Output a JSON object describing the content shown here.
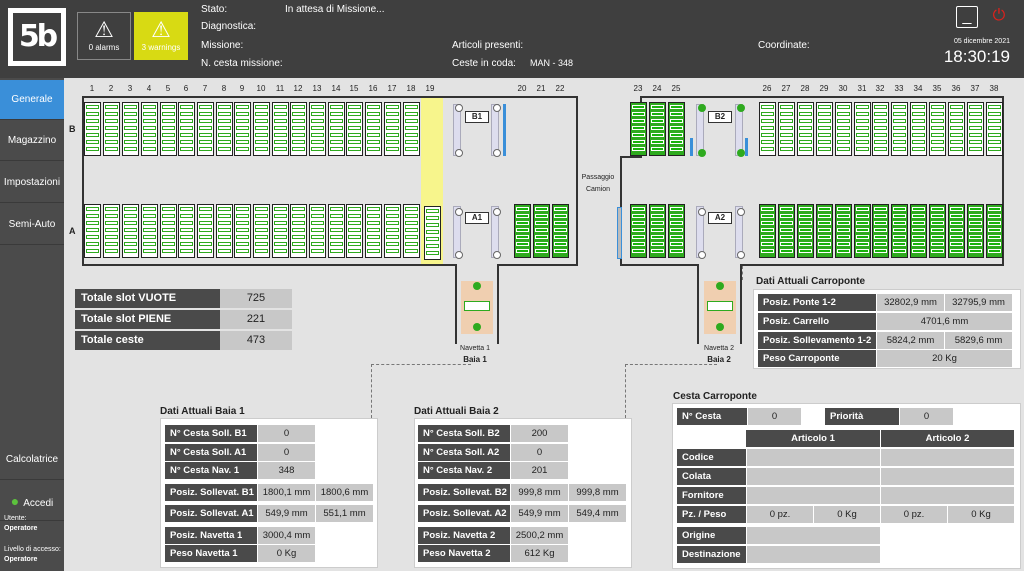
{
  "header": {
    "alarms_label": "0 alarms",
    "warnings_label": "3 warnings",
    "stato_label": "Stato:",
    "stato_value": "In attesa di Missione...",
    "diagnostica_label": "Diagnostica:",
    "missione_label": "Missione:",
    "ncesta_label": "N. cesta missione:",
    "articoli_label": "Articoli presenti:",
    "ceste_label": "Ceste in coda:",
    "ceste_value": "MAN - 348",
    "coordinate_label": "Coordinate:",
    "date": "05 dicembre 2021",
    "time": "18:30:19"
  },
  "sidebar": {
    "items": [
      {
        "label": "Generale"
      },
      {
        "label": "Magazzino"
      },
      {
        "label": "Impostazioni"
      },
      {
        "label": "Semi-Auto"
      }
    ],
    "calcolatrice": "Calcolatrice",
    "accedi": "Accedi",
    "utente_label": "Utente:",
    "utente_value": "Operatore",
    "livello_label": "Livello di accesso:",
    "livello_value": "Operatore"
  },
  "map": {
    "left_cols": [
      "1",
      "2",
      "3",
      "4",
      "5",
      "6",
      "7",
      "8",
      "9",
      "10",
      "11",
      "12",
      "13",
      "14",
      "15",
      "16",
      "17",
      "18",
      "19",
      "20",
      "21",
      "22"
    ],
    "right_cols": [
      "23",
      "24",
      "25",
      "26",
      "27",
      "28",
      "29",
      "30",
      "31",
      "32",
      "33",
      "34",
      "35",
      "36",
      "37",
      "38"
    ],
    "row_b": "B",
    "row_a": "A",
    "b1": "B1",
    "a1": "A1",
    "b2": "B2",
    "a2": "A2",
    "passaggio": "Passaggio",
    "camion": "Camion",
    "navetta1": "Navetta 1",
    "baia1": "Baia 1",
    "navetta2": "Navetta 2",
    "baia2": "Baia 2"
  },
  "summary": [
    {
      "label": "Totale slot VUOTE",
      "value": "725"
    },
    {
      "label": "Totale slot PIENE",
      "value": "221"
    },
    {
      "label": "Totale ceste",
      "value": "473"
    }
  ],
  "carroponte": {
    "title": "Dati Attuali Carroponte",
    "rows": [
      {
        "label": "Posiz. Ponte 1-2",
        "v1": "32802,9 mm",
        "v2": "32795,9 mm"
      },
      {
        "label": "Posiz. Carrello",
        "v1": "4701,6 mm"
      },
      {
        "label": "Posiz. Sollevamento 1-2",
        "v1": "5824,2 mm",
        "v2": "5829,6 mm"
      },
      {
        "label": "Peso Carroponte",
        "v1": "20 Kg"
      }
    ]
  },
  "baia1": {
    "title": "Dati Attuali Baia 1",
    "rows": [
      {
        "label": "N° Cesta Soll. B1",
        "v1": "0"
      },
      {
        "label": "N° Cesta Soll. A1",
        "v1": "0"
      },
      {
        "label": "N° Cesta Nav. 1",
        "v1": "348"
      },
      {
        "label": "Posiz. Sollevat. B1",
        "v1": "1800,1 mm",
        "v2": "1800,6 mm"
      },
      {
        "label": "Posiz. Sollevat. A1",
        "v1": "549,9 mm",
        "v2": "551,1 mm"
      },
      {
        "label": "Posiz. Navetta 1",
        "v1": "3000,4 mm"
      },
      {
        "label": "Peso Navetta 1",
        "v1": "0 Kg"
      }
    ]
  },
  "baia2": {
    "title": "Dati Attuali Baia 2",
    "rows": [
      {
        "label": "N° Cesta Soll. B2",
        "v1": "200"
      },
      {
        "label": "N° Cesta Soll. A2",
        "v1": "0"
      },
      {
        "label": "N° Cesta Nav. 2",
        "v1": "201"
      },
      {
        "label": "Posiz. Sollevat. B2",
        "v1": "999,8 mm",
        "v2": "999,8 mm"
      },
      {
        "label": "Posiz. Sollevat. A2",
        "v1": "549,9 mm",
        "v2": "549,4 mm"
      },
      {
        "label": "Posiz. Navetta 2",
        "v1": "2500,2 mm"
      },
      {
        "label": "Peso Navetta 2",
        "v1": "612 Kg"
      }
    ]
  },
  "cesta": {
    "title": "Cesta Carroponte",
    "ncesta_label": "N° Cesta",
    "ncesta_value": "0",
    "priorita_label": "Priorità",
    "priorita_value": "0",
    "articolo1": "Articolo 1",
    "articolo2": "Articolo 2",
    "codice": "Codice",
    "colata": "Colata",
    "fornitore": "Fornitore",
    "pzpeso": "Pz. / Peso",
    "a1_pz": "0 pz.",
    "a1_kg": "0 Kg",
    "a2_pz": "0 pz.",
    "a2_kg": "0 Kg",
    "origine": "Origine",
    "destinazione": "Destinazione"
  },
  "colors": {
    "accent": "#3a8fd9",
    "full": "#2eaa1e",
    "warning": "#d8da13",
    "power": "#e0201b"
  }
}
